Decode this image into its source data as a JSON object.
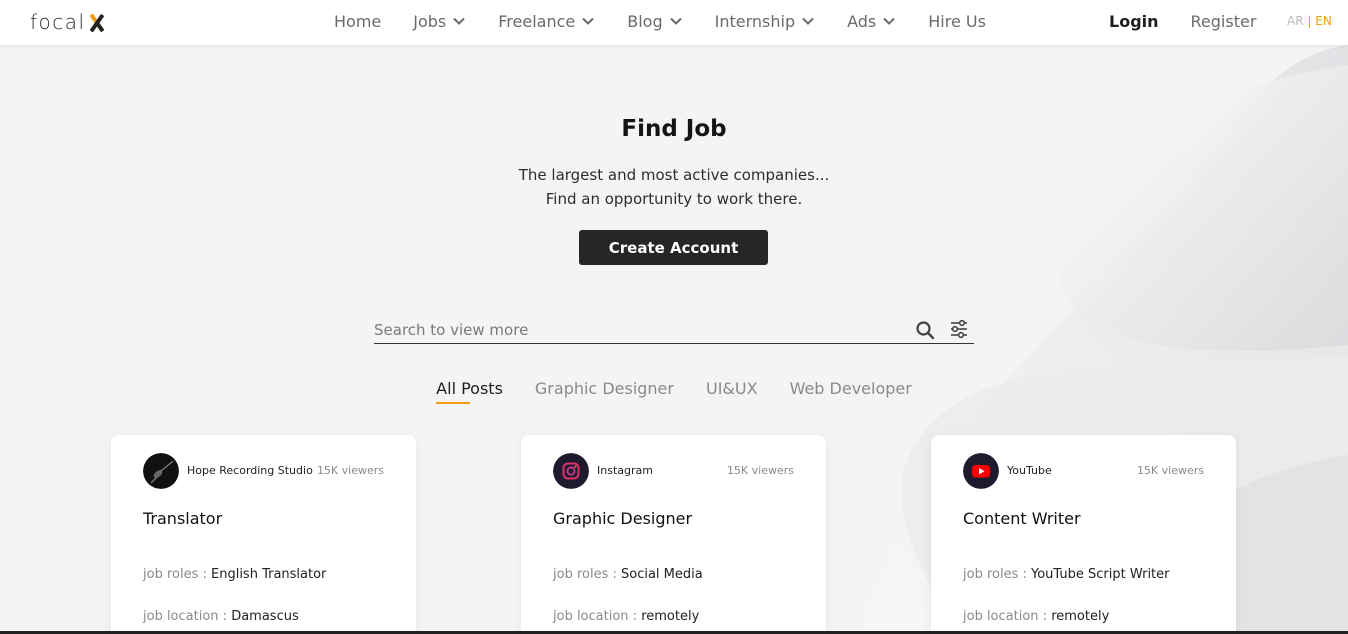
{
  "header": {
    "logo_text": "focal",
    "nav": [
      {
        "label": "Home",
        "dropdown": false
      },
      {
        "label": "Jobs",
        "dropdown": true
      },
      {
        "label": "Freelance",
        "dropdown": true
      },
      {
        "label": "Blog",
        "dropdown": true
      },
      {
        "label": "Internship",
        "dropdown": true
      },
      {
        "label": "Ads",
        "dropdown": true
      },
      {
        "label": "Hire Us",
        "dropdown": false
      }
    ],
    "login_label": "Login",
    "register_label": "Register",
    "lang_ar": "AR",
    "lang_sep": "|",
    "lang_en": "EN",
    "accent_color": "#f39c12"
  },
  "hero": {
    "title": "Find Job",
    "line1": "The largest and most active companies...",
    "line2": "Find an opportunity to work there.",
    "cta_label": "Create Account"
  },
  "search": {
    "placeholder": "Search to view more",
    "value": "",
    "search_icon": "search-icon",
    "filter_icon": "filter-sliders-icon"
  },
  "tabs": [
    {
      "label": "All Posts",
      "active": true
    },
    {
      "label": "Graphic Designer",
      "active": false
    },
    {
      "label": "UI&UX",
      "active": false
    },
    {
      "label": "Web Developer",
      "active": false
    }
  ],
  "cards": [
    {
      "company": "Hope Recording Studio",
      "viewers": "15K viewers",
      "title": "Translator",
      "roles_label": "job roles :",
      "roles": "English Translator",
      "location_label": "job location :",
      "location": "Damascus",
      "avatar_icon": "microphone-icon"
    },
    {
      "company": "Instagram",
      "viewers": "15K viewers",
      "title": "Graphic Designer",
      "roles_label": "job roles :",
      "roles": "Social Media",
      "location_label": "job location :",
      "location": "remotely",
      "avatar_icon": "instagram-icon"
    },
    {
      "company": "YouTube",
      "viewers": "15K viewers",
      "title": "Content Writer",
      "roles_label": "job roles :",
      "roles": "YouTube Script Writer",
      "location_label": "job location :",
      "location": "remotely",
      "avatar_icon": "youtube-icon"
    }
  ]
}
